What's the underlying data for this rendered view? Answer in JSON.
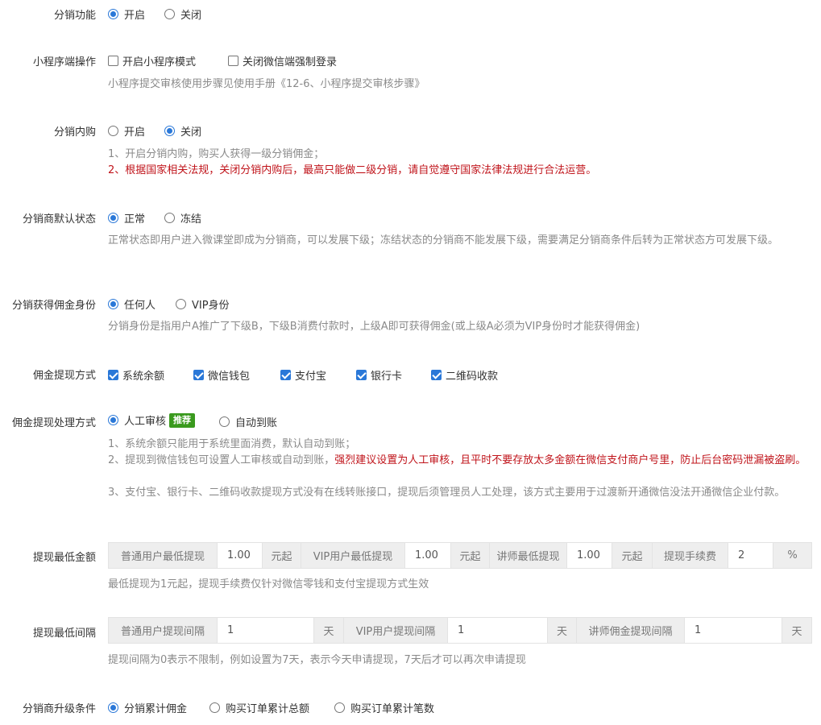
{
  "distribution": {
    "label": "分销功能",
    "options": [
      "开启",
      "关闭"
    ],
    "selected": 0
  },
  "miniprogram": {
    "label": "小程序端操作",
    "options": [
      "开启小程序模式",
      "关闭微信端强制登录"
    ],
    "help": "小程序提交审核使用步骤见使用手册《12-6、小程序提交审核步骤》"
  },
  "internal_purchase": {
    "label": "分销内购",
    "options": [
      "开启",
      "关闭"
    ],
    "selected": 1,
    "help1": "1、开启分销内购，购买人获得一级分销佣金；",
    "help2": "2、根据国家相关法规，关闭分销内购后，最高只能做二级分销，请自觉遵守国家法律法规进行合法运营。"
  },
  "default_status": {
    "label": "分销商默认状态",
    "options": [
      "正常",
      "冻结"
    ],
    "selected": 0,
    "help": "正常状态即用户进入微课堂即成为分销商，可以发展下级；冻结状态的分销商不能发展下级，需要满足分销商条件后转为正常状态方可发展下级。"
  },
  "commission_identity": {
    "label": "分销获得佣金身份",
    "options": [
      "任何人",
      "VIP身份"
    ],
    "selected": 0,
    "help": "分销身份是指用户A推广了下级B，下级B消费付款时，上级A即可获得佣金(或上级A必须为VIP身份时才能获得佣金)"
  },
  "withdraw_method": {
    "label": "佣金提现方式",
    "options": [
      "系统余额",
      "微信钱包",
      "支付宝",
      "银行卡",
      "二维码收款"
    ]
  },
  "withdraw_process": {
    "label": "佣金提现处理方式",
    "options": [
      "人工审核",
      "自动到账"
    ],
    "badge": "推荐",
    "selected": 0,
    "help1": "1、系统余额只能用于系统里面消费，默认自动到账；",
    "help2a": "2、提现到微信钱包可设置人工审核或自动到账，",
    "help2b": "强烈建议设置为人工审核，且平时不要存放太多金额在微信支付商户号里，防止后台密码泄漏被盗刷。",
    "help3": "3、支付宝、银行卡、二维码收款提现方式没有在线转账接口，提现后须管理员人工处理，该方式主要用于过渡新开通微信没法开通微信企业付款。"
  },
  "min_amount": {
    "label": "提现最低金额",
    "user_label": "普通用户最低提现",
    "user_value": "1.00",
    "unit": "元起",
    "vip_label": "VIP用户最低提现",
    "vip_value": "1.00",
    "teacher_label": "讲师最低提现",
    "teacher_value": "1.00",
    "fee_label": "提现手续费",
    "fee_value": "2",
    "fee_unit": "%",
    "help": "最低提现为1元起，提现手续费仅针对微信零钱和支付宝提现方式生效"
  },
  "min_interval": {
    "label": "提现最低间隔",
    "user_label": "普通用户提现间隔",
    "user_value": "1",
    "unit": "天",
    "vip_label": "VIP用户提现间隔",
    "vip_value": "1",
    "teacher_label": "讲师佣金提现间隔",
    "teacher_value": "1",
    "help": "提现间隔为0表示不限制，例如设置为7天，表示今天申请提现，7天后才可以再次申请提现"
  },
  "upgrade": {
    "label": "分销商升级条件",
    "options": [
      "分销累计佣金",
      "购买订单累计总额",
      "购买订单累计笔数"
    ],
    "selected": 0
  }
}
